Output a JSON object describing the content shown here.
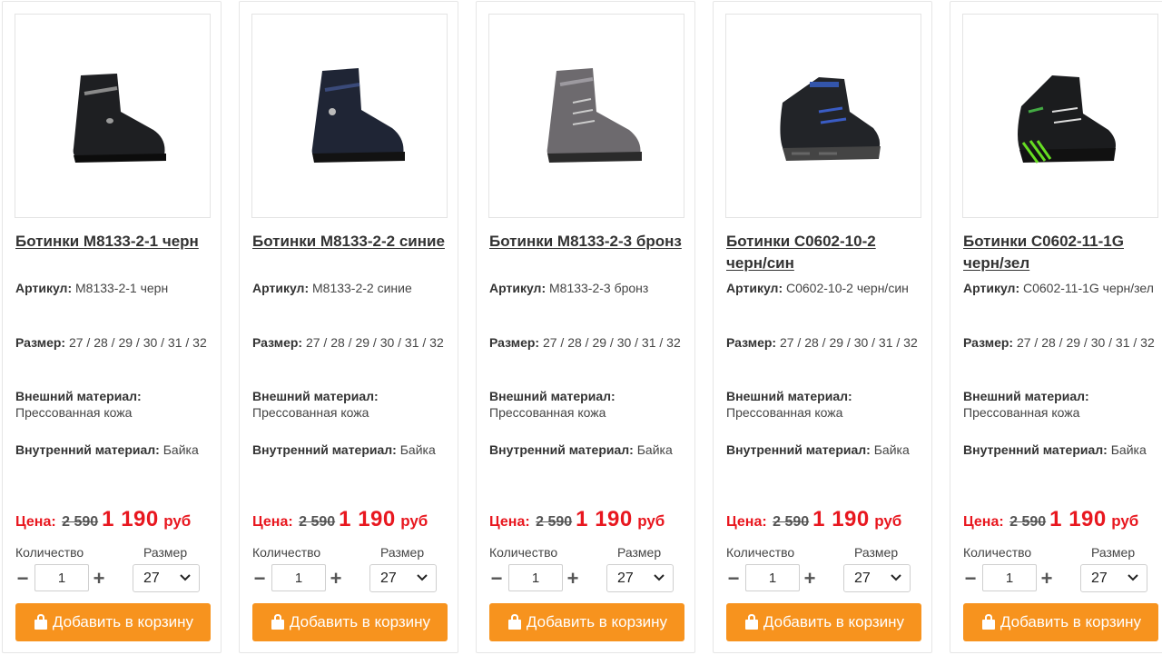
{
  "labels": {
    "article": "Артикул:",
    "size": "Размер:",
    "outer": "Внешний материал:",
    "inner": "Внутренний материал:",
    "price": "Цена:",
    "currency": "руб",
    "quantity": "Количество",
    "size_select": "Размер",
    "add_to_cart": "Добавить в корзину",
    "minus": "−",
    "plus": "+"
  },
  "colors": {
    "accent_button": "#f7931e",
    "price_red": "#e8171f"
  },
  "products": [
    {
      "name": "Ботинки M8133-2-1 черн",
      "article": "M8133-2-1 черн",
      "sizes": "27 / 28 / 29 / 30 / 31 / 32",
      "outer_material": "Прессованная кожа",
      "inner_material": "Байка",
      "old_price": "2 590",
      "new_price": "1 190",
      "quantity": "1",
      "selected_size": "27",
      "image_icon": "black-boot-image"
    },
    {
      "name": "Ботинки M8133-2-2 синие",
      "article": "M8133-2-2 синие",
      "sizes": "27 / 28 / 29 / 30 / 31 / 32",
      "outer_material": "Прессованная кожа",
      "inner_material": "Байка",
      "old_price": "2 590",
      "new_price": "1 190",
      "quantity": "1",
      "selected_size": "27",
      "image_icon": "navy-boot-image"
    },
    {
      "name": "Ботинки M8133-2-3 бронз",
      "article": "M8133-2-3 бронз",
      "sizes": "27 / 28 / 29 / 30 / 31 / 32",
      "outer_material": "Прессованная кожа",
      "inner_material": "Байка",
      "old_price": "2 590",
      "new_price": "1 190",
      "quantity": "1",
      "selected_size": "27",
      "image_icon": "bronze-boot-image"
    },
    {
      "name": "Ботинки C0602-10-2 черн/син",
      "article": "C0602-10-2 черн/син",
      "sizes": "27 / 28 / 29 / 30 / 31 / 32",
      "outer_material": "Прессованная кожа",
      "inner_material": "Байка",
      "old_price": "2 590",
      "new_price": "1 190",
      "quantity": "1",
      "selected_size": "27",
      "image_icon": "black-blue-sneaker-boot-image"
    },
    {
      "name": "Ботинки C0602-11-1G черн/зел",
      "article": "C0602-11-1G черн/зел",
      "sizes": "27 / 28 / 29 / 30 / 31 / 32",
      "outer_material": "Прессованная кожа",
      "inner_material": "Байка",
      "old_price": "2 590",
      "new_price": "1 190",
      "quantity": "1",
      "selected_size": "27",
      "image_icon": "black-green-sneaker-boot-image"
    }
  ]
}
